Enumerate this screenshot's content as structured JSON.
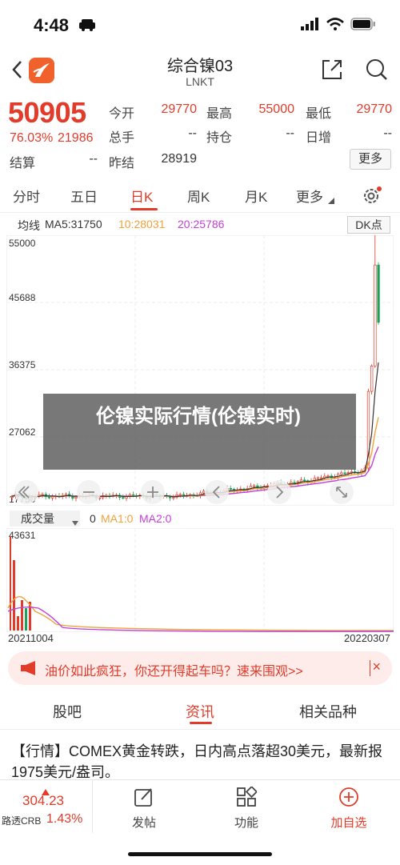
{
  "status": {
    "time": "4:48"
  },
  "header": {
    "title": "综合镍03",
    "subtitle": "LNKT"
  },
  "quote": {
    "price": "50905",
    "change_pct": "76.03%",
    "change": "21986",
    "labels": {
      "open": "今开",
      "high": "最高",
      "low": "最低",
      "volume": "总手",
      "oi": "持仓",
      "daily_inc": "日增",
      "settle": "结算",
      "prev_settle": "昨结"
    },
    "values": {
      "open": "29770",
      "high": "55000",
      "low": "29770",
      "volume": "--",
      "oi": "--",
      "daily_inc": "--",
      "settle": "--",
      "prev_settle": "28919"
    },
    "more_label": "更多"
  },
  "period_tabs": [
    "分时",
    "五日",
    "日K",
    "周K",
    "月K",
    "更多"
  ],
  "active_period": "日K",
  "ma": {
    "label": "均线",
    "ma5": "MA5:31750",
    "ma10": "10:28031",
    "ma20": "20:25786",
    "dk_label": "DK点",
    "colors": {
      "ma5": "#333333",
      "ma10": "#f0a23a",
      "ma20": "#c43fd8"
    }
  },
  "kchart": {
    "y_ticks": [
      "55000",
      "45688",
      "36375",
      "27062",
      "17750"
    ]
  },
  "volume": {
    "select_label": "成交量",
    "v0": "0",
    "ma1": "MA1:0",
    "ma2": "MA2:0",
    "y_top": "43631",
    "date_start": "20211004",
    "date_end": "20220307"
  },
  "overlay": {
    "text": "伦镍实际行情(伦镍实时)"
  },
  "ad": {
    "text": "油价如此疯狂，你还开得起车吗？速来围观>>",
    "close": "×"
  },
  "section_tabs": [
    "股吧",
    "资讯",
    "相关品种"
  ],
  "active_section": "资讯",
  "news": {
    "text": "【行情】COMEX黄金转跌，日内高点落超30美元，最新报1975美元/盎司。"
  },
  "bottom": {
    "price": "304.23",
    "name": "路透CRB",
    "pct": "1.43%",
    "post": "发帖",
    "func": "功能",
    "watch": "加自选"
  },
  "colors": {
    "accent": "#e23b2a",
    "up": "#e23b2a",
    "down": "#1aa35c"
  }
}
